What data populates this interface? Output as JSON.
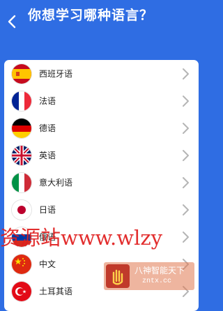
{
  "header": {
    "title": "你想学习哪种语言？",
    "back_icon": "chevron-left-icon"
  },
  "languages": [
    {
      "label": "西班牙语",
      "flag": "spain-flag-icon"
    },
    {
      "label": "法语",
      "flag": "france-flag-icon"
    },
    {
      "label": "德语",
      "flag": "germany-flag-icon"
    },
    {
      "label": "英语",
      "flag": "uk-flag-icon"
    },
    {
      "label": "意大利语",
      "flag": "italy-flag-icon"
    },
    {
      "label": "日语",
      "flag": "japan-flag-icon"
    },
    {
      "label": "俄语",
      "flag": "russia-flag-icon"
    },
    {
      "label": "中文",
      "flag": "china-flag-icon"
    },
    {
      "label": "土耳其语",
      "flag": "turkey-flag-icon"
    }
  ],
  "watermark": {
    "text": "资源站www.wlzy",
    "stamp_name": "八神智能天下",
    "stamp_url": "zntx.cc"
  },
  "colors": {
    "background": "#2f6de3",
    "card": "#ffffff",
    "chevron": "#b5b5b5",
    "watermark": "#e01c1c"
  }
}
